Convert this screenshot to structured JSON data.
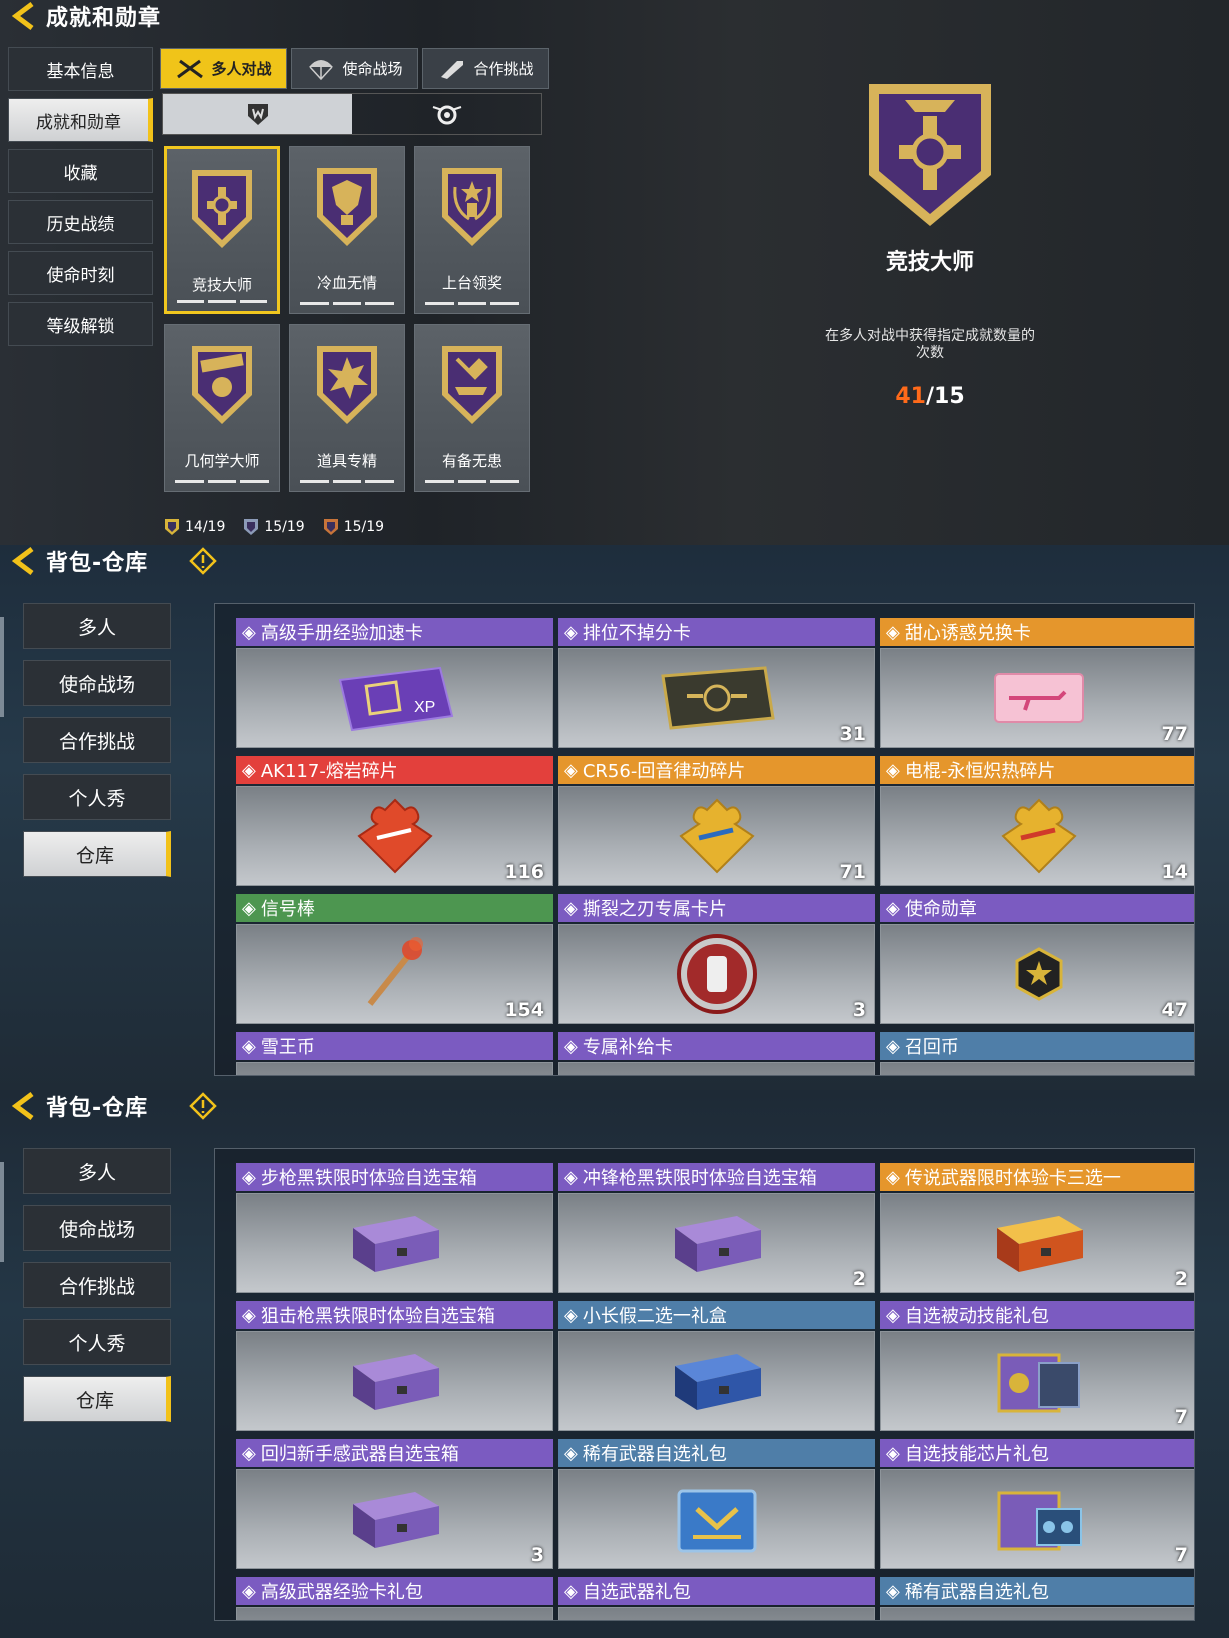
{
  "panel1": {
    "title": "成就和勋章",
    "sidebar": [
      "基本信息",
      "成就和勋章",
      "收藏",
      "历史战绩",
      "使命时刻",
      "等级解锁"
    ],
    "sidebar_active": 1,
    "tabs": [
      "多人对战",
      "使命战场",
      "合作挑战"
    ],
    "tab_active": 0,
    "medals": [
      {
        "label": "竞技大师",
        "icon": "cross-medal-icon"
      },
      {
        "label": "冷血无情",
        "icon": "dragon-medal-icon"
      },
      {
        "label": "上台领奖",
        "icon": "trophy-medal-icon"
      },
      {
        "label": "几何学大师",
        "icon": "boom-grenade-medal-icon"
      },
      {
        "label": "道具专精",
        "icon": "explosion-medal-icon"
      },
      {
        "label": "有备无患",
        "icon": "shovel-medal-icon"
      }
    ],
    "stats": [
      {
        "value": "14/19",
        "color": "#d8b43a"
      },
      {
        "value": "15/19",
        "color": "#8c9bb8"
      },
      {
        "value": "15/19",
        "color": "#c7743a"
      }
    ],
    "detail": {
      "name": "竞技大师",
      "description": "在多人对战中获得指定成就数量的次数",
      "progress_current": "41",
      "progress_total": "/15"
    }
  },
  "panel2": {
    "title": "背包-仓库",
    "sidebar": [
      "多人",
      "使命战场",
      "合作挑战",
      "个人秀",
      "仓库"
    ],
    "sidebar_active": 4,
    "items": [
      {
        "name": "高级手册经验加速卡",
        "rarity": "purple",
        "count": "",
        "icon": "xp-card-icon"
      },
      {
        "name": "排位不掉分卡",
        "rarity": "purple",
        "count": "31",
        "icon": "rank-card-icon"
      },
      {
        "name": "甜心诱惑兑换卡",
        "rarity": "orange",
        "count": "77",
        "icon": "pink-card-icon"
      },
      {
        "name": "AK117-熔岩碎片",
        "rarity": "red",
        "count": "116",
        "icon": "red-puzzle-icon"
      },
      {
        "name": "CR56-回音律动碎片",
        "rarity": "orange",
        "count": "71",
        "icon": "gold-puzzle-icon"
      },
      {
        "name": "电棍-永恒炽热碎片",
        "rarity": "orange",
        "count": "14",
        "icon": "gold-puzzle-icon"
      },
      {
        "name": "信号棒",
        "rarity": "green",
        "count": "154",
        "icon": "flare-icon"
      },
      {
        "name": "撕裂之刃专属卡片",
        "rarity": "purple",
        "count": "3",
        "icon": "round-badge-icon"
      },
      {
        "name": "使命勋章",
        "rarity": "purple",
        "count": "47",
        "icon": "hex-star-icon"
      },
      {
        "name": "雪王币",
        "rarity": "purple",
        "count": "",
        "icon": ""
      },
      {
        "name": "专属补给卡",
        "rarity": "purple",
        "count": "",
        "icon": ""
      },
      {
        "name": "召回币",
        "rarity": "blue",
        "count": "",
        "icon": ""
      }
    ]
  },
  "panel3": {
    "title": "背包-仓库",
    "sidebar": [
      "多人",
      "使命战场",
      "合作挑战",
      "个人秀",
      "仓库"
    ],
    "sidebar_active": 4,
    "items": [
      {
        "name": "步枪黑铁限时体验自选宝箱",
        "rarity": "purple",
        "count": "",
        "icon": "purple-crate-icon"
      },
      {
        "name": "冲锋枪黑铁限时体验自选宝箱",
        "rarity": "purple",
        "count": "2",
        "icon": "purple-crate-icon"
      },
      {
        "name": "传说武器限时体验卡三选一",
        "rarity": "orange",
        "count": "2",
        "icon": "gold-crate-icon"
      },
      {
        "name": "狙击枪黑铁限时体验自选宝箱",
        "rarity": "purple",
        "count": "",
        "icon": "purple-crate-icon"
      },
      {
        "name": "小长假二选一礼盒",
        "rarity": "blue",
        "count": "",
        "icon": "blue-crate-icon"
      },
      {
        "name": "自选被动技能礼包",
        "rarity": "purple",
        "count": "7",
        "icon": "skill-case-icon"
      },
      {
        "name": "回归新手感武器自选宝箱",
        "rarity": "purple",
        "count": "3",
        "icon": "purple-crate-icon"
      },
      {
        "name": "稀有武器自选礼包",
        "rarity": "blue",
        "count": "",
        "icon": "weapon-case-icon"
      },
      {
        "name": "自选技能芯片礼包",
        "rarity": "purple",
        "count": "7",
        "icon": "chip-case-icon"
      },
      {
        "name": "高级武器经验卡礼包",
        "rarity": "purple",
        "count": "",
        "icon": ""
      },
      {
        "name": "自选武器礼包",
        "rarity": "purple",
        "count": "",
        "icon": ""
      },
      {
        "name": "稀有武器自选礼包",
        "rarity": "blue",
        "count": "",
        "icon": ""
      }
    ]
  },
  "colors": {
    "accent": "#f2c21a",
    "purple": "#7b5bc1",
    "orange": "#e5962c",
    "red": "#e3403c",
    "green": "#4d9650",
    "blue": "#4f7ea8",
    "progress_current": "#ff6a1a"
  }
}
